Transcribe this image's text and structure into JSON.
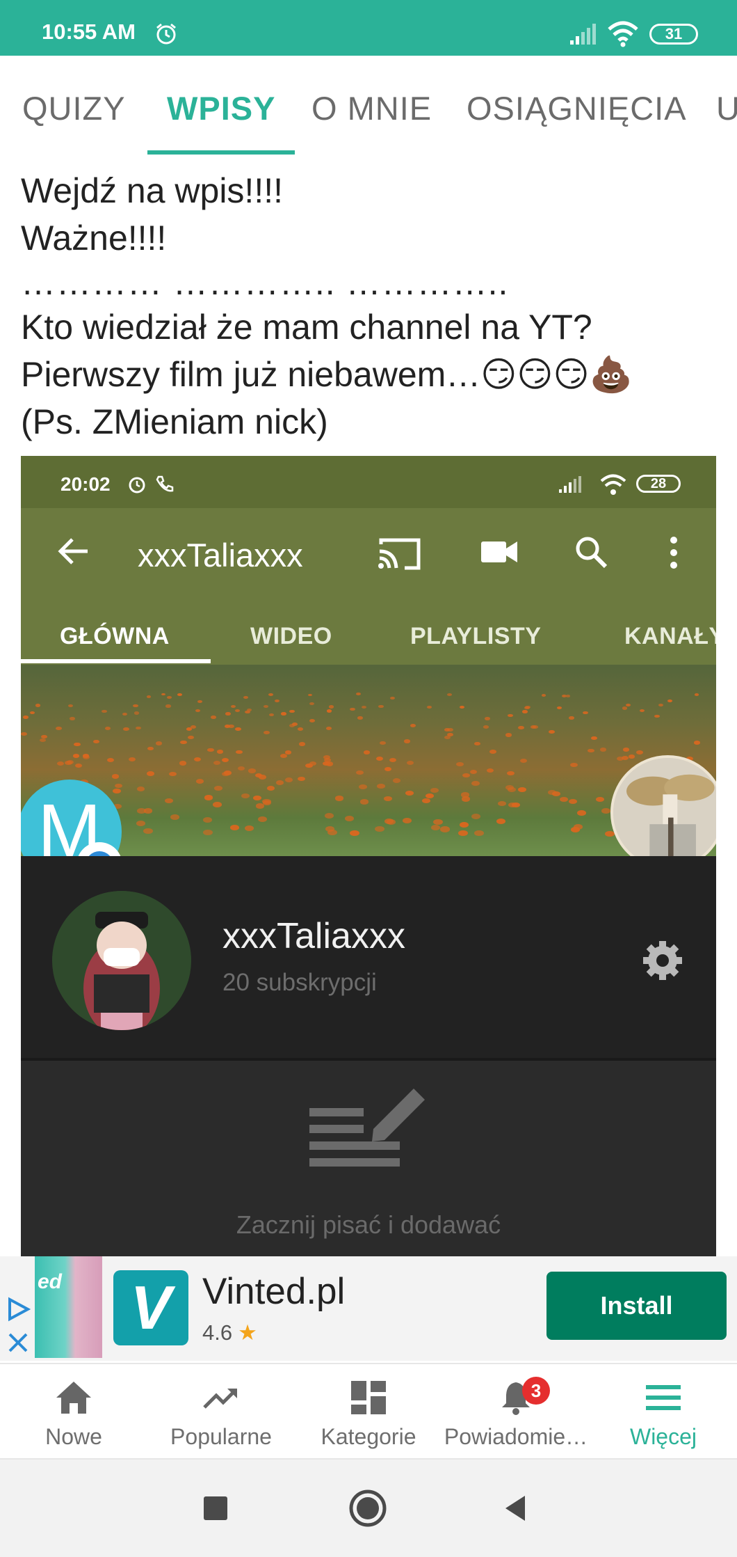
{
  "status_bar": {
    "time": "10:55 AM",
    "battery": "31"
  },
  "tabs": [
    {
      "label": "QUIZY"
    },
    {
      "label": "WPISY"
    },
    {
      "label": "O MNIE"
    },
    {
      "label": "OSIĄGNIĘCIA"
    },
    {
      "label": "U"
    }
  ],
  "post": {
    "lines": [
      "Wejdź na wpis!!!!",
      "Ważne!!!!",
      "………… ………….. …………..",
      "Kto wiedział że mam channel na YT?",
      "Pierwszy film już niebawem…😏😏😏💩",
      "(Ps. ZMieniam nick)"
    ]
  },
  "screenshot": {
    "status_time": "20:02",
    "battery": "28",
    "title": "xxxTaliaxxx",
    "tabs": [
      "GŁÓWNA",
      "WIDEO",
      "PLAYLISTY",
      "KANAŁY"
    ],
    "avatar_letter": "M",
    "channel_name": "xxxTaliaxxx",
    "subscribers": "20 subskrypcji",
    "empty_text": "Zacznij pisać i dodawać"
  },
  "ad": {
    "thumb_text": "ed",
    "logo_letter": "V",
    "name": "Vinted.pl",
    "rating": "4.6",
    "star": "★",
    "install": "Install"
  },
  "bottom_nav": [
    {
      "label": "Nowe",
      "icon": "home-icon"
    },
    {
      "label": "Popularne",
      "icon": "trending-icon"
    },
    {
      "label": "Kategorie",
      "icon": "dashboard-icon"
    },
    {
      "label": "Powiadomie…",
      "icon": "bell-icon",
      "badge": "3"
    },
    {
      "label": "Więcej",
      "icon": "menu-icon",
      "active": true
    }
  ],
  "colors": {
    "accent": "#2bb298",
    "install": "#007d5e",
    "badge": "#e52e2e"
  }
}
